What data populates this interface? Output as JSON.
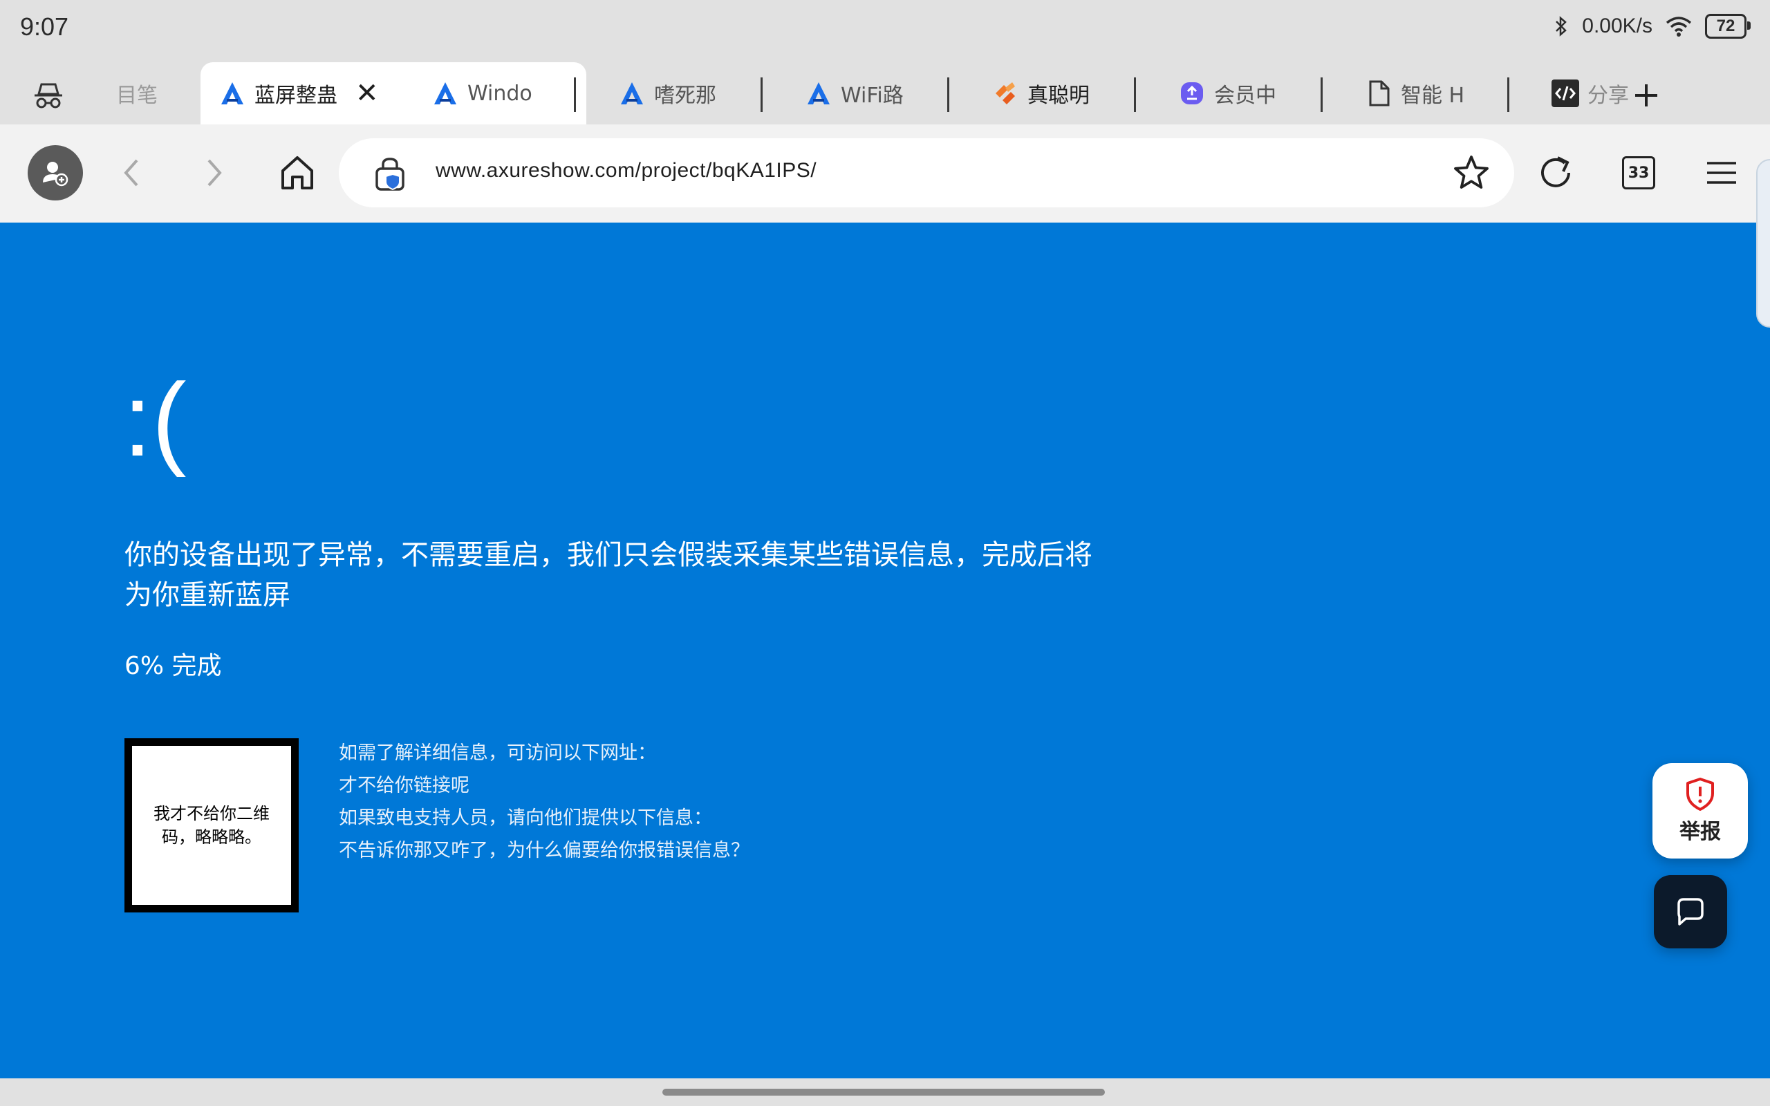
{
  "status_bar": {
    "time": "9:07",
    "network_speed": "0.00K/s",
    "battery": "72"
  },
  "tabs": [
    {
      "label": "目​笔",
      "icon": "incognito-icon",
      "fade": true
    },
    {
      "label": "蓝屏整蛊",
      "icon": "axure-logo-icon",
      "active": true
    },
    {
      "label": "Windo",
      "icon": "axure-logo-icon",
      "fade": true
    },
    {
      "label": "嗜死那",
      "icon": "axure-logo-icon",
      "fade": true
    },
    {
      "label": "WiFi路",
      "icon": "axure-logo-icon",
      "fade": true
    },
    {
      "label": "真聪明",
      "icon": "orange-logo-icon"
    },
    {
      "label": "会员中",
      "icon": "purple-logo-icon",
      "fade": true
    },
    {
      "label": "智能 H",
      "icon": "document-icon",
      "fade": true
    },
    {
      "label": "分享",
      "icon": "code-icon",
      "fade": true
    }
  ],
  "toolbar": {
    "url": "www.axureshow.com/project/bqKA1IPS/",
    "tab_count": "33"
  },
  "bsod": {
    "face": ":(",
    "message": "你的设备出现了异常，不需要重启，我们只会假装采集某些错误信息，完成后将为你重新蓝屏",
    "progress": "6% 完成",
    "qr_text": "我才不给你二维码，略略略。",
    "info": [
      "如需了解详细信息，可访问以下网址：",
      "才不给你链接呢",
      "如果致电支持人员，请向他们提供以下信息：",
      "不告诉你那又咋了，为什么偏要给你报错误信息？"
    ]
  },
  "report": {
    "label": "举报"
  },
  "colors": {
    "bsod_blue": "#0078d7",
    "chrome": "#e1e1e1",
    "toolbar": "#f2f2f2"
  }
}
